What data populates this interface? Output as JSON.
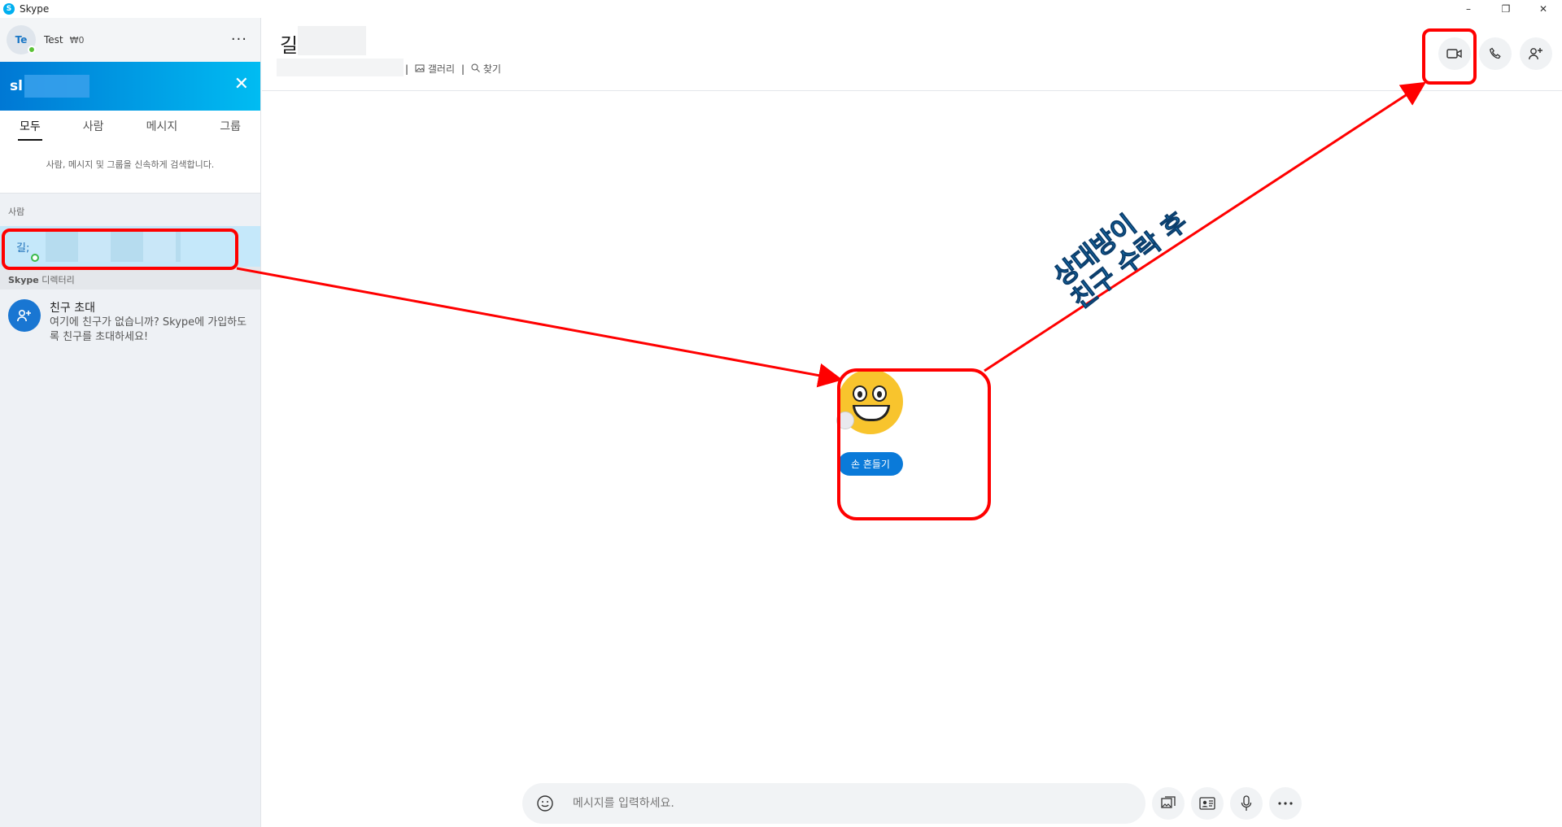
{
  "window": {
    "title": "Skype",
    "controls": {
      "minimize": "–",
      "restore": "❐",
      "close": "✕"
    }
  },
  "sidebar": {
    "profile": {
      "initials": "Te",
      "name": "Test",
      "credit": "₩0",
      "more": "···"
    },
    "search": {
      "value": "sl",
      "close": "✕"
    },
    "tabs": [
      {
        "label": "모두",
        "active": true
      },
      {
        "label": "사람",
        "active": false
      },
      {
        "label": "메시지",
        "active": false
      },
      {
        "label": "그룹",
        "active": false
      }
    ],
    "hint": "사람, 메시지 및 그룹을 신속하게 검색합니다.",
    "people_section": "사람",
    "contact": {
      "name": "길;"
    },
    "directory_section": {
      "brand": "Skype",
      "label": " 디렉터리"
    },
    "invite": {
      "title": "친구 초대",
      "description": "여기에 친구가 없습니까? Skype에 가입하도록 친구를 초대하세요!"
    }
  },
  "chat": {
    "title": "길;",
    "gallery": "갤러리",
    "find": "찾기",
    "welcome": {
      "wave_button": "손 흔들기"
    },
    "composer": {
      "placeholder": "메시지를 입력하세요."
    }
  },
  "annotation": {
    "line1": "상대방이",
    "line2": "친구 수락 후",
    "color": "#ff0000"
  },
  "colors": {
    "accent": "#0078d4",
    "selected_row": "#c5e8fa",
    "annotation_red": "#ff0000"
  }
}
